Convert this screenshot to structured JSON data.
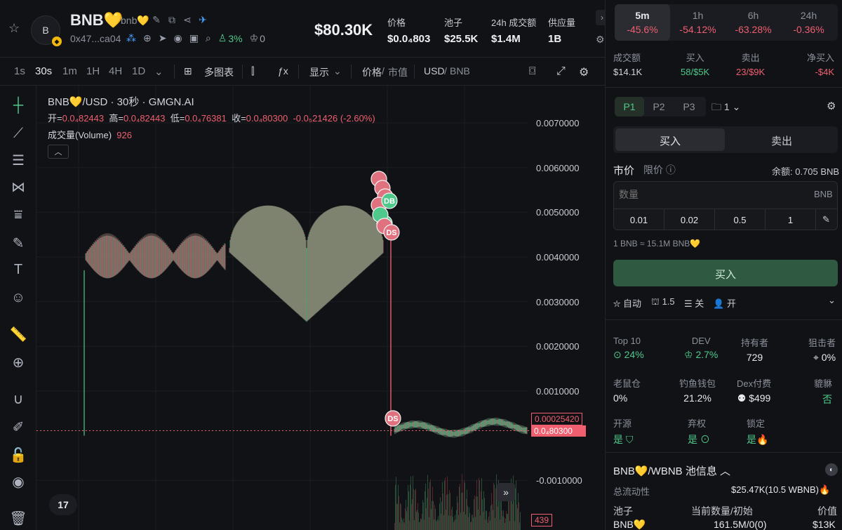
{
  "header": {
    "token_name": "BNB💛",
    "token_sub": "bnb💛",
    "address": "0x47...ca04",
    "logo_letter": "B",
    "holder_pct": "3%",
    "crown_count": "0",
    "price": "$80.30K",
    "stats": [
      {
        "label": "价格",
        "value": "$0.0₄803"
      },
      {
        "label": "池子",
        "value": "$25.5K"
      },
      {
        "label": "24h 成交额",
        "value": "$1.4M"
      },
      {
        "label": "供应量",
        "value": "1B"
      }
    ]
  },
  "toolbar": {
    "timeframes": [
      "1s",
      "30s",
      "1m",
      "1H",
      "4H",
      "1D"
    ],
    "active_timeframe": "30s",
    "multi_chart": "多图表",
    "display": "显示",
    "price_label": "价格",
    "mcap_label": "市值",
    "usd_label": "USD",
    "bnb_label": "BNB"
  },
  "chart": {
    "title": "BNB💛/USD · 30秒 · GMGN.AI",
    "ohlc": {
      "open_label": "开=",
      "open": "0.0₄82443",
      "high_label": "高=",
      "high": "0.0₄82443",
      "low_label": "低=",
      "low": "0.0₄76381",
      "close_label": "收=",
      "close": "0.0₄80300",
      "change": "-0.0₅21426 (-2.60%)"
    },
    "volume_label": "成交量(Volume)",
    "volume_value": "926",
    "y_ticks": [
      "0.0070000",
      "0.0060000",
      "0.0050000",
      "0.0040000",
      "0.0030000",
      "0.0020000",
      "0.0010000",
      "-0.0010000"
    ],
    "price_tag_1": "0.00025420",
    "price_tag_2": "0.0₄80300",
    "vol_tag": "439",
    "marker_db": "DB",
    "marker_ds": "DS",
    "tv_logo": "17"
  },
  "chart_data": {
    "type": "candlestick",
    "title": "BNB💛/USD · 30秒 · GMGN.AI",
    "y_axis_ticks": [
      0.007,
      0.006,
      0.005,
      0.004,
      0.003,
      0.002,
      0.001,
      -0.001
    ],
    "last_price": 0.000803,
    "marked_price": 0.0002542,
    "open": 0.0008244,
    "high": 0.0008244,
    "low": 0.0007638,
    "close": 0.000803,
    "volume": 926
  },
  "right": {
    "tf_tabs": [
      {
        "label": "5m",
        "value": "-45.6%"
      },
      {
        "label": "1h",
        "value": "-54.12%"
      },
      {
        "label": "6h",
        "value": "-63.28%"
      },
      {
        "label": "24h",
        "value": "-0.36%"
      }
    ],
    "trade_stats": [
      {
        "label": "成交额",
        "value": "$14.1K"
      },
      {
        "label": "买入",
        "value_a": "58",
        "value_b": "/$5K"
      },
      {
        "label": "卖出",
        "value_a": "23",
        "value_b": "/$9K"
      },
      {
        "label": "净买入",
        "value": "-$4K"
      }
    ],
    "p_tabs": [
      "P1",
      "P2",
      "P3"
    ],
    "wallet_count": "1",
    "buy_tab": "买入",
    "sell_tab": "卖出",
    "market": "市价",
    "limit": "限价",
    "balance": "余额: 0.705 BNB",
    "qty_placeholder": "数量",
    "qty_unit": "BNB",
    "presets": [
      "0.01",
      "0.02",
      "0.5",
      "1"
    ],
    "rate": "1 BNB ≈ 15.1M BNB💛",
    "buy_button": "买入",
    "auto": "自动",
    "slippage": "1.5",
    "mev_off": "关",
    "mev_on": "开",
    "holders": [
      {
        "label": "Top 10",
        "value": "24%"
      },
      {
        "label": "DEV",
        "value": "2.7%"
      },
      {
        "label": "持有者",
        "value": "729"
      },
      {
        "label": "狙击者",
        "value": "0%"
      }
    ],
    "holders2": [
      {
        "label": "老鼠仓",
        "value": "0%"
      },
      {
        "label": "钓鱼钱包",
        "value": "21.2%"
      },
      {
        "label": "Dex付费",
        "value": "$499"
      },
      {
        "label": "貔貅",
        "value": "否"
      }
    ],
    "flags": [
      {
        "label": "开源",
        "value": "是"
      },
      {
        "label": "弃权",
        "value": "是"
      },
      {
        "label": "锁定",
        "value": "是"
      }
    ],
    "pool_title": "BNB💛/WBNB 池信息",
    "liquidity_label": "总流动性",
    "liquidity_value": "$25.47K(10.5 WBNB)",
    "pool_col1": "池子",
    "pool_col2": "当前数量/初始",
    "pool_col3": "价值",
    "pool_row_token": "BNB💛",
    "pool_row_amount": "161.5M/0(0)",
    "pool_row_value": "$13K"
  }
}
